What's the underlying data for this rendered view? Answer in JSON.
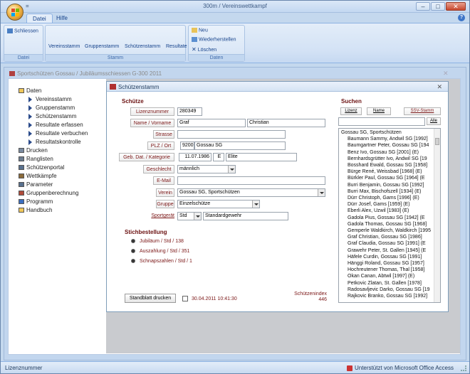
{
  "window": {
    "title": "300m / Vereinswettkampf",
    "qat": "="
  },
  "ribbon": {
    "tabs": [
      "Datei",
      "Hilfe"
    ],
    "groups": {
      "datei": {
        "label": "Datei",
        "buttons": [
          "Schliessen"
        ]
      },
      "stamm": {
        "label": "Stamm",
        "buttons": [
          "Vereinsstamm",
          "Gruppenstamm",
          "Schützenstamm",
          "Resultate"
        ]
      },
      "daten": {
        "label": "Daten",
        "buttons": [
          "Neu",
          "Wiederherstellen",
          "Löschen"
        ]
      }
    },
    "help": "?"
  },
  "document": {
    "title": "Sportschützen Gossau  /  Jubiläumsschiessen G-300 2011"
  },
  "tree": [
    {
      "label": "Daten",
      "indent": 0,
      "icon": "folder-icon"
    },
    {
      "label": "Vereinsstamm",
      "indent": 1,
      "icon": "arrow-icon"
    },
    {
      "label": "Gruppenstamm",
      "indent": 1,
      "icon": "arrow-icon"
    },
    {
      "label": "Schützenstamm",
      "indent": 1,
      "icon": "arrow-icon"
    },
    {
      "label": "Resultate erfassen",
      "indent": 1,
      "icon": "arrow-icon"
    },
    {
      "label": "Resultate verbuchen",
      "indent": 1,
      "icon": "arrow-icon"
    },
    {
      "label": "Resultatskontrolle",
      "indent": 1,
      "icon": "arrow-icon"
    },
    {
      "label": "Drucken",
      "indent": 0,
      "icon": "printer-icon"
    },
    {
      "label": "Ranglisten",
      "indent": 0,
      "icon": "list-icon"
    },
    {
      "label": "Schützenportal",
      "indent": 0,
      "icon": "gear-icon"
    },
    {
      "label": "Wettkämpfe",
      "indent": 0,
      "icon": "cross-icon"
    },
    {
      "label": "Parameter",
      "indent": 0,
      "icon": "gear-icon"
    },
    {
      "label": "Gruppenberechnung",
      "indent": 0,
      "icon": "grid-icon"
    },
    {
      "label": "Programm",
      "indent": 0,
      "icon": "info-icon"
    },
    {
      "label": "Handbuch",
      "indent": 0,
      "icon": "folder-icon"
    }
  ],
  "dialog": {
    "title": "Schützenstamm",
    "section_schuetze": "Schütze",
    "labels": {
      "lizenznummer": "Lizenznummer",
      "name": "Name / Vorname",
      "strasse": "Strasse",
      "plz": "PLZ / Ort",
      "geb": "Geb. Dat. / Kategorie",
      "geschlecht": "Geschlecht",
      "email": "E-Mail",
      "verein": "Verein",
      "gruppe": "Gruppe",
      "sportgeraet": "Sportgerät"
    },
    "values": {
      "lizenznummer": "280349",
      "name": "Graf",
      "vorname": "Christian",
      "strasse": "",
      "plz": "9200",
      "ort": "Gossau SG",
      "geb": "11.07.1986",
      "kat": "E",
      "kategorie": "Elite",
      "geschlecht": "männlich",
      "email": "",
      "verein": "Gossau SG, Sportschützen",
      "gruppe": "Einzelschütze",
      "sportgeraet": "Std",
      "sportgeraet_name": "Standardgewehr"
    },
    "section_stich": "Stichbestellung",
    "stiche": [
      "Jubiläum / Std / 138",
      "Auszahlung / Std / 351",
      "Schnapszahlen / Std / 1"
    ],
    "print_button": "Standblatt drucken",
    "timestamp": "30.04.2011 10:41:30",
    "index_label": "Schützenindex",
    "index_value": "446",
    "search": {
      "title": "Suchen",
      "buttons": [
        "Lizenz",
        "Name",
        "SSV-Stamm"
      ],
      "all_button": "Alle",
      "input": "",
      "items": [
        "Gossau SG, Sportschützen",
        "Baumann Sammy, Andwil SG [1992]",
        "Baumgartner Peter, Gossau SG [194",
        "Benz Ivo, Gossau SG [2001]  (E)",
        "Bernhardsgrütter Ivo, Andwil SG [19",
        "Bosshard Ewald, Gossau SG [1958]",
        "Bürge René, Weissbad [1968]  (E)",
        "Bürkler Paul, Gossau SG [1964]  (E",
        "Burri Benjamin, Gossau SG [1992]",
        "Burri Max, Bischofszell [1934]  (E)",
        "Dürr Christoph, Gams [1996]  (E)",
        "Dürr Josef, Gams [1959]  (E)",
        "Eberli Alex, Uzwil [1983]  (E)",
        "Gadola Pius, Gossau SG [1942]  (E",
        "Gadola Thomas, Gossau SG [1968]",
        "Gemperle Waldkirch, Waldkirch [1995",
        "Graf Christian, Gossau SG [1986]",
        "Graf Claudia, Gossau SG [1991]  (E",
        "Grawehr Peter, St. Gallen [1945]  (E",
        "Häfele Curdin, Gossau SG [1991]",
        "Hänggi Roland, Gossau SG [1957]",
        "Hochreutener Thomas, Thal [1958]",
        "Okan Canan, Abtwil [1997]  (E)",
        "Petkovic Zlatan, St. Gallen [1978]",
        "Radosavljevic Darko, Gossau SG [19",
        "Rajkovic Branko, Gossau SG [1992]"
      ]
    }
  },
  "status": {
    "left": "Lizenznummer",
    "right": "Unterstützt von Microsoft Office Access"
  }
}
